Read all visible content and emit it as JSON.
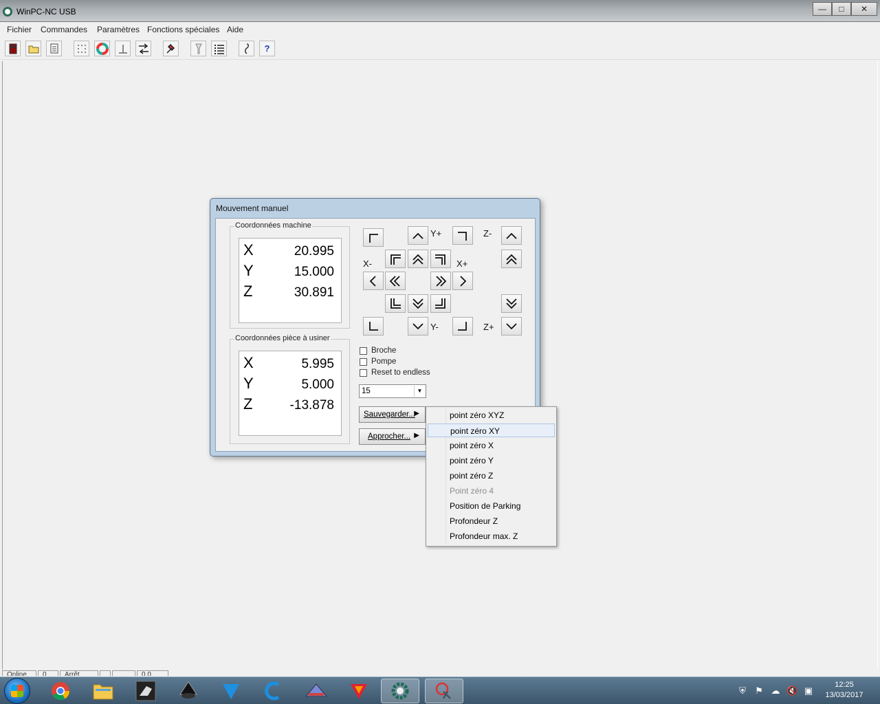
{
  "window": {
    "title": "WinPC-NC USB",
    "controls": {
      "minimize": "—",
      "maximize": "□",
      "close": "✕"
    }
  },
  "menu": [
    "Fichier",
    "Commandes",
    "Paramètres",
    "Fonctions spéciales",
    "Aide"
  ],
  "toolbar_icons": [
    "exit-icon",
    "open-folder-icon",
    "document-icon",
    "grid-icon",
    "color-wheel-icon",
    "anchor-icon",
    "arrows-swap-icon",
    "tools-icon",
    "tool-change-icon",
    "list-icon",
    "info-icon",
    "help-icon"
  ],
  "toolbar_help": "?",
  "dialog": {
    "title": "Mouvement manuel",
    "machine_coords": {
      "label": "Coordonnées machine",
      "rows": [
        {
          "axis": "X",
          "value": "20.995"
        },
        {
          "axis": "Y",
          "value": "15.000"
        },
        {
          "axis": "Z",
          "value": "30.891"
        }
      ]
    },
    "workpiece_coords": {
      "label": "Coordonnées pièce à usiner",
      "rows": [
        {
          "axis": "X",
          "value": "5.995"
        },
        {
          "axis": "Y",
          "value": "5.000"
        },
        {
          "axis": "Z",
          "value": "-13.878"
        }
      ]
    },
    "jog_labels": {
      "y_plus": "Y+",
      "y_minus": "Y-",
      "x_minus": "X-",
      "x_plus": "X+",
      "z_minus": "Z-",
      "z_plus": "Z+"
    },
    "checkboxes": [
      {
        "label": "Broche",
        "checked": false
      },
      {
        "label": "Pompe",
        "checked": false
      },
      {
        "label": "Reset to endless",
        "checked": false
      }
    ],
    "speed_select": "15",
    "save_button": "Sauvegarder...",
    "approach_button": "Approcher..."
  },
  "context_menu": {
    "items": [
      {
        "label": "point zéro XYZ",
        "state": "normal"
      },
      {
        "label": "point zéro XY",
        "state": "hover"
      },
      {
        "label": "point zéro X",
        "state": "normal"
      },
      {
        "label": "point zéro Y",
        "state": "normal"
      },
      {
        "label": "point zéro Z",
        "state": "normal"
      },
      {
        "label": "Point zéro 4",
        "state": "disabled"
      },
      {
        "label": "Position de Parking",
        "state": "normal"
      },
      {
        "label": "Profondeur Z",
        "state": "normal"
      },
      {
        "label": "Profondeur max. Z",
        "state": "normal"
      }
    ]
  },
  "statusbar": [
    "Online",
    "0",
    "Arrêt",
    "",
    "0.0"
  ],
  "taskbar": {
    "apps": [
      "chrome-icon",
      "file-explorer-icon",
      "cnc-app-icon",
      "inkscape-icon",
      "vector-app-icon",
      "ccleaner-icon",
      "router-app-icon",
      "3d-app-icon",
      "winpc-nc-icon",
      "snipping-tool-icon"
    ],
    "clock_time": "12:25",
    "clock_date": "13/03/2017"
  },
  "colors": {
    "dialog_frame": "#bcd0e4",
    "taskbar": "#4a6780",
    "menu_hover": "#e8eff8"
  }
}
